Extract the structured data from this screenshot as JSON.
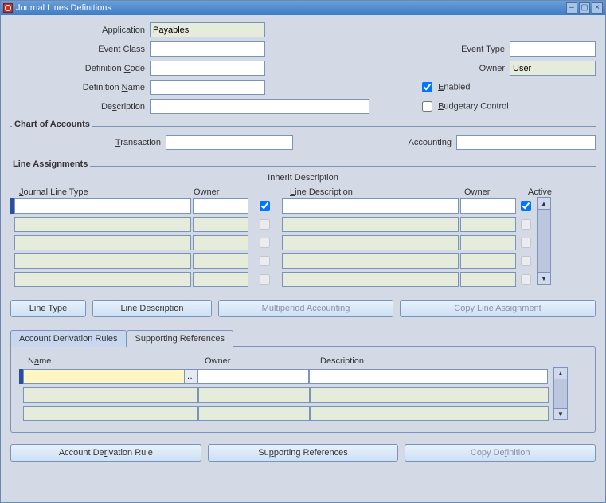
{
  "window": {
    "title": "Journal Lines Definitions"
  },
  "form": {
    "application_label": "Application",
    "application_value": "Payables",
    "event_class_label": "Event Class",
    "event_class_value": "",
    "definition_code_label": "Definition Code",
    "definition_code_value": "",
    "definition_name_label": "Definition Name",
    "definition_name_value": "",
    "description_label": "Description",
    "description_value": "",
    "event_type_label": "Event Type",
    "event_type_value": "",
    "owner_label": "Owner",
    "owner_value": "User",
    "enabled_label": "Enabled",
    "enabled_checked": true,
    "budgetary_label": "Budgetary Control",
    "budgetary_checked": false
  },
  "chart": {
    "title": "Chart of Accounts",
    "transaction_label": "Transaction",
    "transaction_value": "",
    "accounting_label": "Accounting",
    "accounting_value": ""
  },
  "line_assignments": {
    "title": "Line Assignments",
    "inherit_title": "Inherit Description",
    "col_jlt": "Journal Line Type",
    "col_owner": "Owner",
    "col_line_desc": "Line Description",
    "col_active": "Active",
    "rows": [
      {
        "jlt": "",
        "owner1": "",
        "inherit": true,
        "ldesc": "",
        "owner2": "",
        "active": true,
        "current": true
      },
      {
        "jlt": "",
        "owner1": "",
        "inherit": false,
        "ldesc": "",
        "owner2": "",
        "active": false,
        "current": false,
        "disabled": true
      },
      {
        "jlt": "",
        "owner1": "",
        "inherit": false,
        "ldesc": "",
        "owner2": "",
        "active": false,
        "current": false,
        "disabled": true
      },
      {
        "jlt": "",
        "owner1": "",
        "inherit": false,
        "ldesc": "",
        "owner2": "",
        "active": false,
        "current": false,
        "disabled": true
      },
      {
        "jlt": "",
        "owner1": "",
        "inherit": false,
        "ldesc": "",
        "owner2": "",
        "active": false,
        "current": false,
        "disabled": true
      }
    ]
  },
  "buttons_mid": {
    "line_type": "Line Type",
    "line_desc": "Line Description",
    "multi": "Multiperiod Accounting",
    "copy_la": "Copy Line Assignment"
  },
  "tabs": {
    "adr": "Account Derivation Rules",
    "sr": "Supporting References",
    "active": "sr"
  },
  "refs": {
    "col_name": "Name",
    "col_owner": "Owner",
    "col_desc": "Description",
    "rows": [
      {
        "name": "",
        "owner": "",
        "desc": "",
        "current": true,
        "yellow": true
      },
      {
        "name": "",
        "owner": "",
        "desc": "",
        "current": false,
        "disabled": true
      },
      {
        "name": "",
        "owner": "",
        "desc": "",
        "current": false,
        "disabled": true
      }
    ]
  },
  "buttons_bottom": {
    "adr": "Account Derivation Rule",
    "sr": "Supporting References",
    "copy_def": "Copy Definition"
  }
}
